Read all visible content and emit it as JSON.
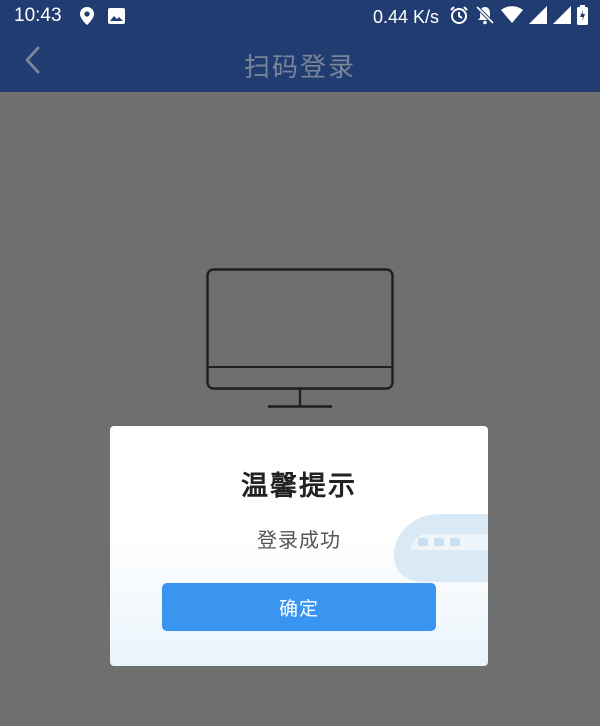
{
  "status_bar": {
    "time": "10:43",
    "network_speed": "0.44 K/s",
    "icons_left": [
      "location-icon",
      "image-icon"
    ],
    "icons_right": [
      "alarm-icon",
      "notifications-off-icon",
      "wifi-icon",
      "signal-icon",
      "signal-icon",
      "battery-icon"
    ]
  },
  "nav": {
    "title": "扫码登录",
    "back_icon": "chevron-left-icon"
  },
  "main": {
    "illustration": "monitor-icon"
  },
  "dialog": {
    "title": "温馨提示",
    "message": "登录成功",
    "confirm_label": "确定",
    "decoration": "train-icon"
  },
  "colors": {
    "header_bg": "#203c70",
    "overlay_bg": "#6f6f6f",
    "button_bg": "#3a95f0",
    "nav_title": "#7a8599"
  }
}
